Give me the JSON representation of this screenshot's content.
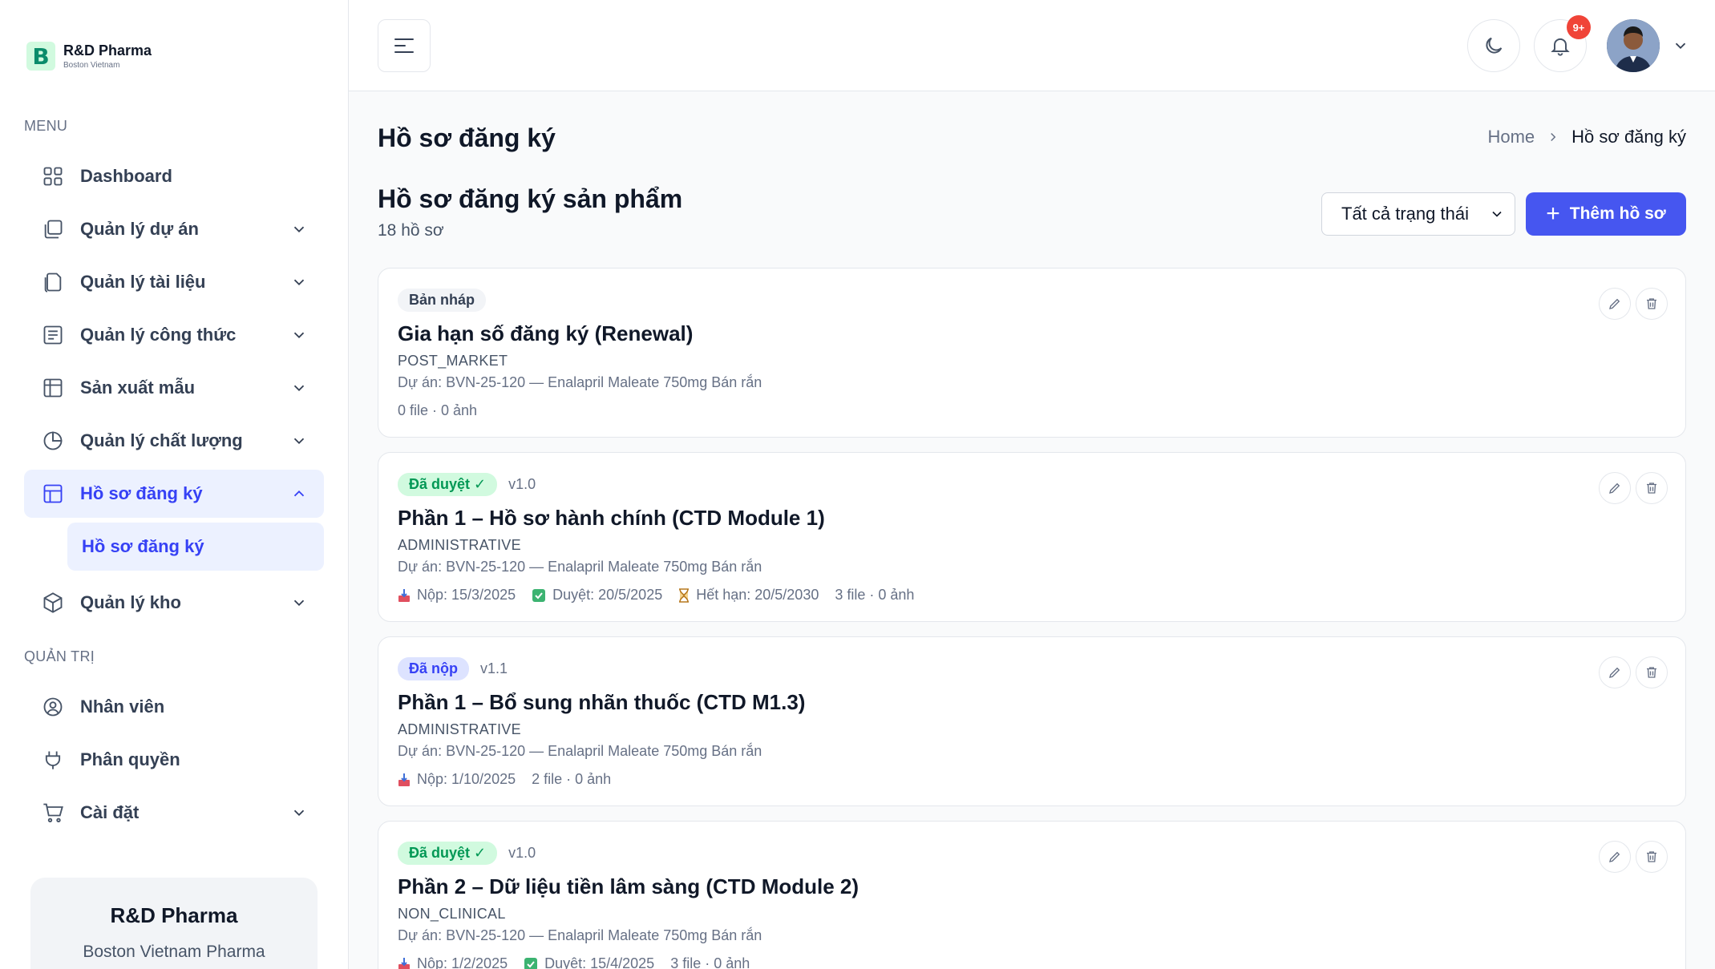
{
  "brand": {
    "logo_letter": "B",
    "name": "R&D Pharma",
    "subtitle": "Boston Vietnam"
  },
  "sidebar": {
    "menu_label": "MENU",
    "items": [
      {
        "label": "Dashboard",
        "icon": "grid-icon"
      },
      {
        "label": "Quản lý dự án",
        "icon": "copy-icon"
      },
      {
        "label": "Quản lý tài liệu",
        "icon": "document-icon"
      },
      {
        "label": "Quản lý công thức",
        "icon": "list-icon"
      },
      {
        "label": "Sản xuất mẫu",
        "icon": "table-icon"
      },
      {
        "label": "Quản lý chất lượng",
        "icon": "pie-chart-icon"
      },
      {
        "label": "Hồ sơ đăng ký",
        "icon": "layout-icon"
      },
      {
        "label": "Quản lý kho",
        "icon": "box-icon"
      }
    ],
    "active_sub_item": "Hồ sơ đăng ký",
    "admin_label": "QUẢN TRỊ",
    "admin_items": [
      {
        "label": "Nhân viên",
        "icon": "user-circle-icon"
      },
      {
        "label": "Phân quyền",
        "icon": "plug-icon"
      },
      {
        "label": "Cài đặt",
        "icon": "cart-icon"
      }
    ],
    "promo": {
      "title": "R&D Pharma",
      "subtitle": "Boston Vietnam Pharma"
    }
  },
  "header": {
    "notification_count": "9+"
  },
  "page": {
    "title": "Hồ sơ đăng ký",
    "breadcrumb": {
      "home": "Home",
      "current": "Hồ sơ đăng ký"
    },
    "list_title": "Hồ sơ đăng ký sản phẩm",
    "list_count": "18 hồ sơ",
    "status_filter": "Tất cả trạng thái",
    "add_button": "Thêm hồ sơ"
  },
  "records": [
    {
      "status": "Bản nháp",
      "version": "",
      "title": "Gia hạn số đăng ký (Renewal)",
      "type": "POST_MARKET",
      "project": "Dự án: BVN-25-120 — Enalapril Maleate 750mg Bán rắn",
      "submitted": "",
      "approved": "",
      "expiry": "",
      "files": "0 file · 0 ảnh"
    },
    {
      "status": "Đã duyệt ✓",
      "version": "v1.0",
      "title": "Phần 1 – Hồ sơ hành chính (CTD Module 1)",
      "type": "ADMINISTRATIVE",
      "project": "Dự án: BVN-25-120 — Enalapril Maleate 750mg Bán rắn",
      "submitted": "Nộp: 15/3/2025",
      "approved": "Duyệt: 20/5/2025",
      "expiry": "Hết hạn: 20/5/2030",
      "files": "3 file · 0 ảnh"
    },
    {
      "status": "Đã nộp",
      "version": "v1.1",
      "title": "Phần 1 – Bổ sung nhãn thuốc (CTD M1.3)",
      "type": "ADMINISTRATIVE",
      "project": "Dự án: BVN-25-120 — Enalapril Maleate 750mg Bán rắn",
      "submitted": "Nộp: 1/10/2025",
      "approved": "",
      "expiry": "",
      "files": "2 file · 0 ảnh"
    },
    {
      "status": "Đã duyệt ✓",
      "version": "v1.0",
      "title": "Phần 2 – Dữ liệu tiền lâm sàng (CTD Module 2)",
      "type": "NON_CLINICAL",
      "project": "Dự án: BVN-25-120 — Enalapril Maleate 750mg Bán rắn",
      "submitted": "Nộp: 1/2/2025",
      "approved": "Duyệt: 15/4/2025",
      "expiry": "",
      "files": "3 file · 0 ảnh"
    }
  ],
  "colors": {
    "accent": "#4656f0",
    "active_bg": "#ecf1ff",
    "approved": "#039855",
    "badge": "#f04438"
  }
}
